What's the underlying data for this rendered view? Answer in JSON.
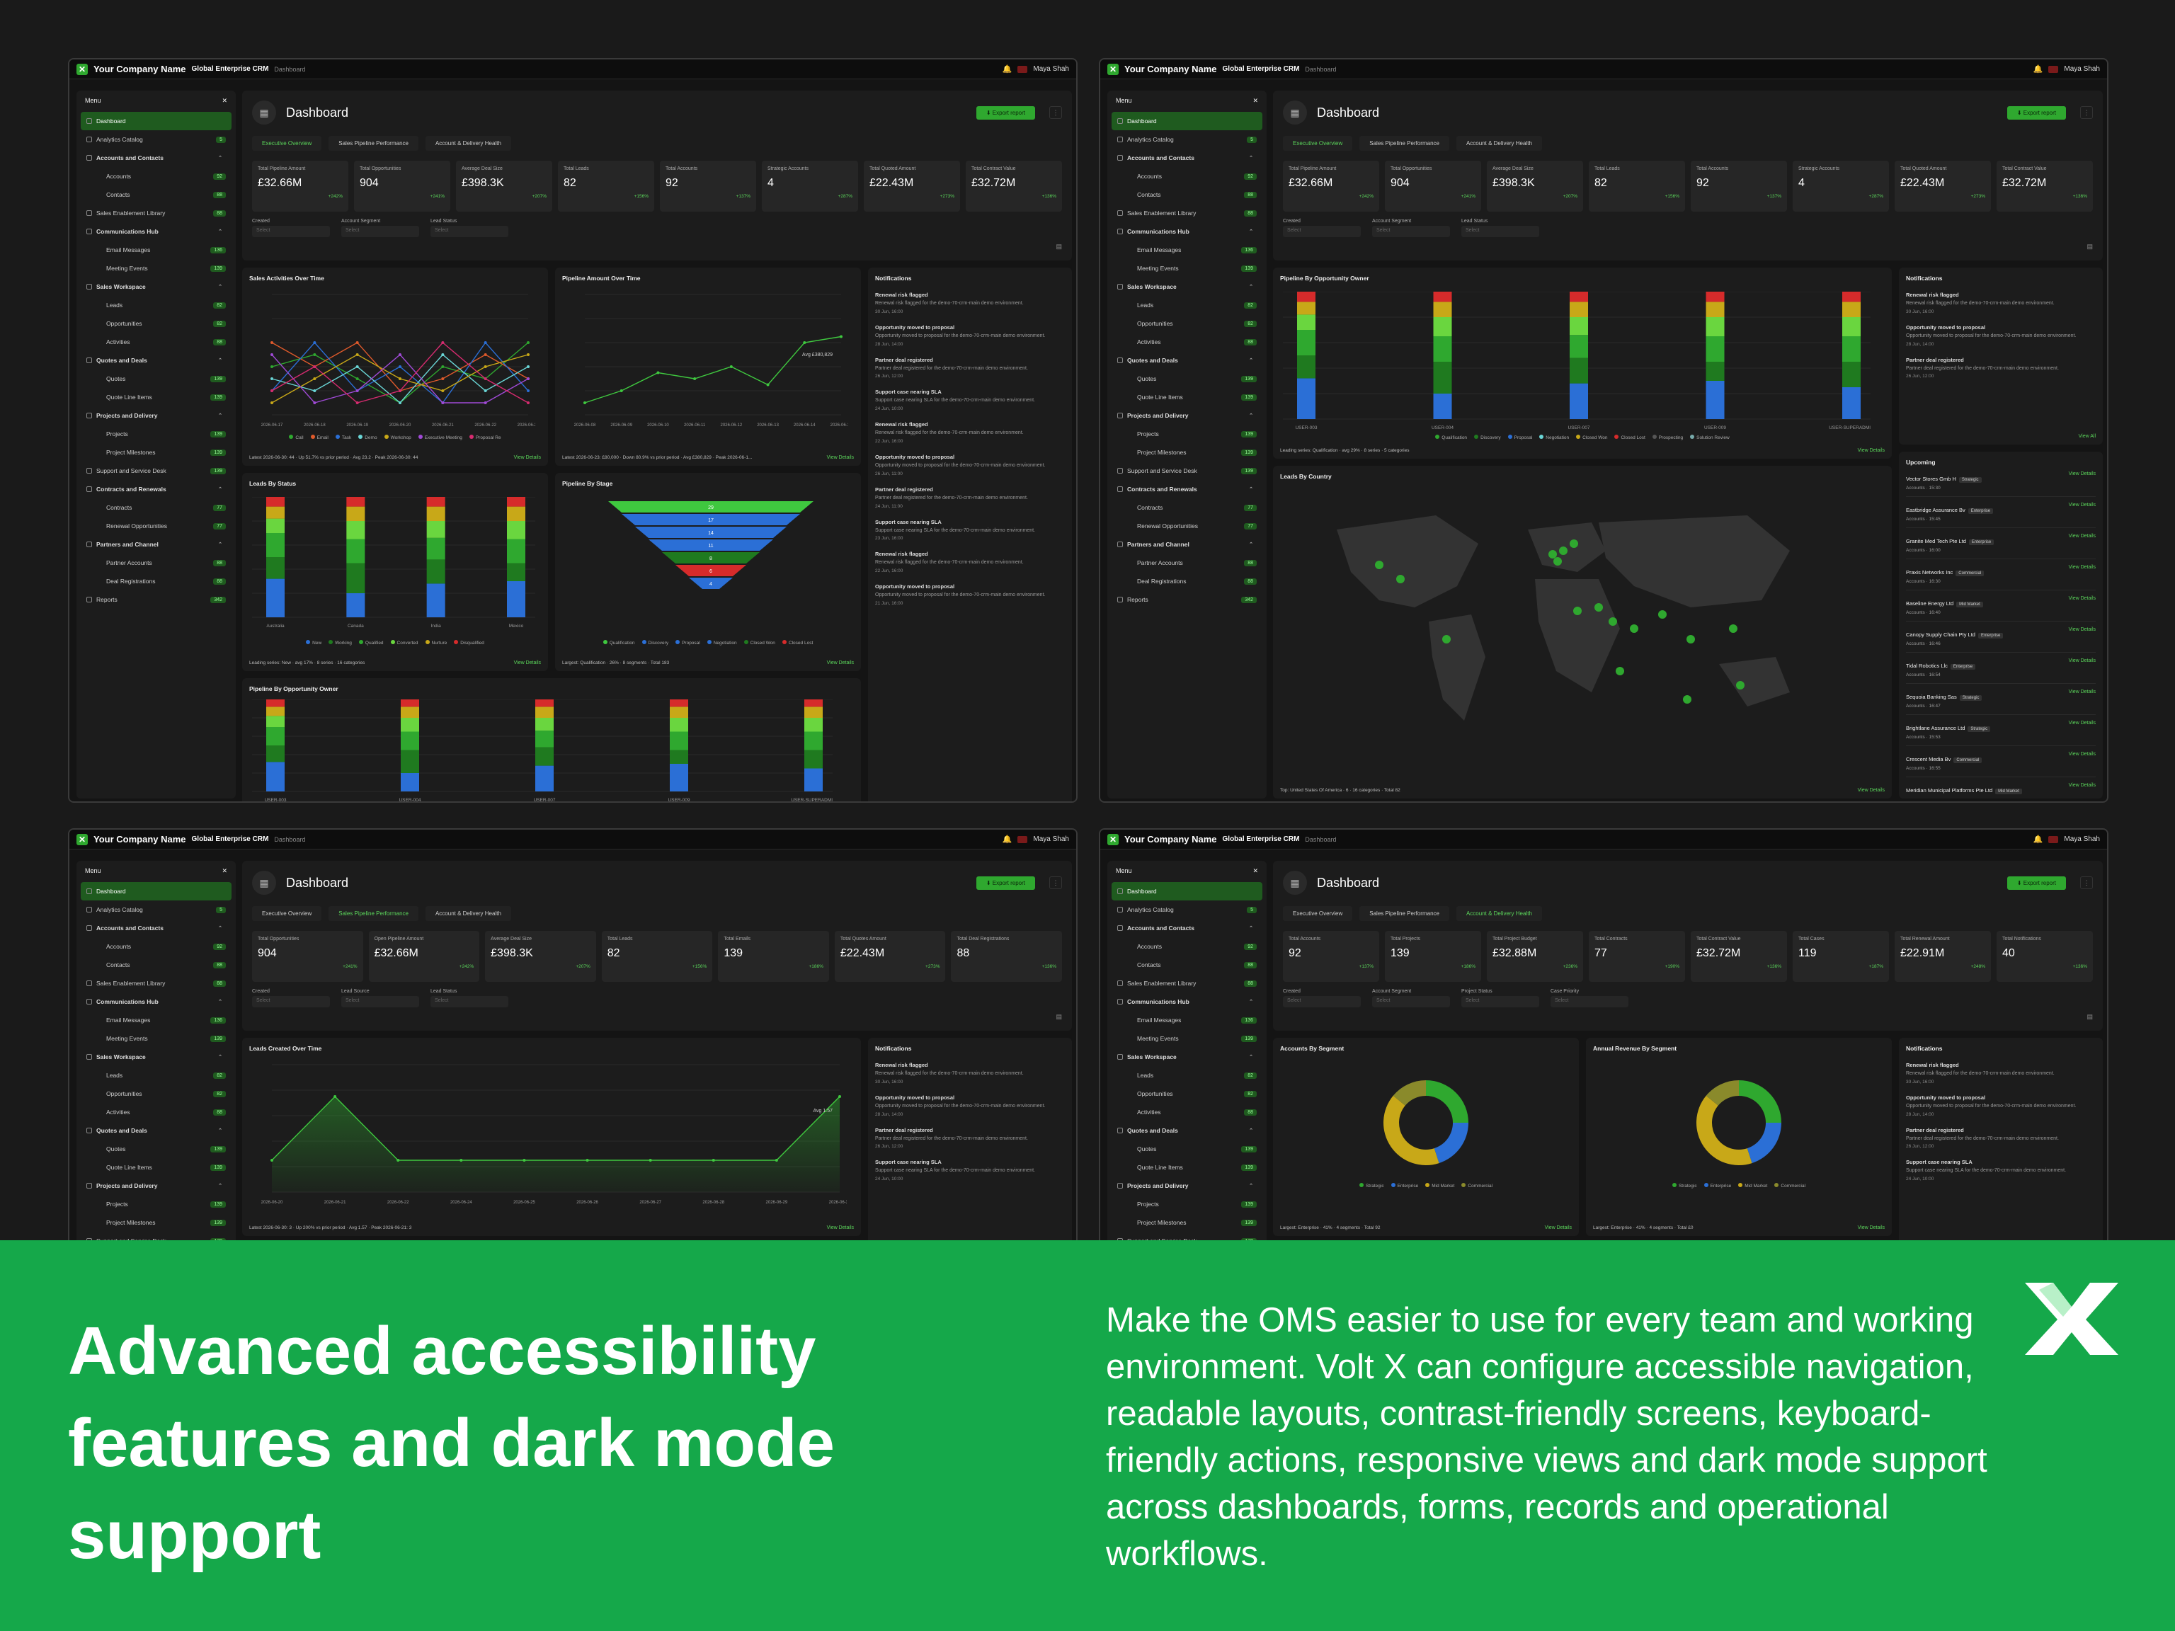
{
  "app": {
    "company": "Your Company Name",
    "crm": "Global Enterprise CRM",
    "crumb": "Dashboard",
    "user": "Maya Shah",
    "page_title": "Dashboard",
    "export_label": "Export report",
    "menu_label": "Menu"
  },
  "sidebar": {
    "items": [
      {
        "label": "Dashboard",
        "type": "active"
      },
      {
        "label": "Analytics Catalog",
        "type": "item",
        "badge": "5"
      },
      {
        "label": "Accounts and Contacts",
        "type": "sec"
      },
      {
        "label": "Accounts",
        "type": "sub",
        "badge": "92"
      },
      {
        "label": "Contacts",
        "type": "sub",
        "badge": "88"
      },
      {
        "label": "Sales Enablement Library",
        "type": "item",
        "badge": "88"
      },
      {
        "label": "Communications Hub",
        "type": "sec"
      },
      {
        "label": "Email Messages",
        "type": "sub",
        "badge": "136"
      },
      {
        "label": "Meeting Events",
        "type": "sub",
        "badge": "139"
      },
      {
        "label": "Sales Workspace",
        "type": "sec"
      },
      {
        "label": "Leads",
        "type": "sub",
        "badge": "82"
      },
      {
        "label": "Opportunities",
        "type": "sub",
        "badge": "82"
      },
      {
        "label": "Activities",
        "type": "sub",
        "badge": "88"
      },
      {
        "label": "Quotes and Deals",
        "type": "sec"
      },
      {
        "label": "Quotes",
        "type": "sub",
        "badge": "139"
      },
      {
        "label": "Quote Line Items",
        "type": "sub",
        "badge": "139"
      },
      {
        "label": "Projects and Delivery",
        "type": "sec"
      },
      {
        "label": "Projects",
        "type": "sub",
        "badge": "139"
      },
      {
        "label": "Project Milestones",
        "type": "sub",
        "badge": "139"
      },
      {
        "label": "Support and Service Desk",
        "type": "item",
        "badge": "139"
      },
      {
        "label": "Contracts and Renewals",
        "type": "sec"
      },
      {
        "label": "Contracts",
        "type": "sub",
        "badge": "77"
      },
      {
        "label": "Renewal Opportunities",
        "type": "sub",
        "badge": "77"
      },
      {
        "label": "Partners and Channel",
        "type": "sec"
      },
      {
        "label": "Partner Accounts",
        "type": "sub",
        "badge": "88"
      },
      {
        "label": "Deal Registrations",
        "type": "sub",
        "badge": "88"
      },
      {
        "label": "Reports",
        "type": "item",
        "badge": "342"
      }
    ]
  },
  "tabs": [
    "Executive Overview",
    "Sales Pipeline Performance",
    "Account & Delivery Health"
  ],
  "screens": {
    "s1": {
      "active_tab": 0,
      "kpis": [
        {
          "label": "Total Pipeline Amount",
          "value": "£32.66M",
          "delta": "+242%"
        },
        {
          "label": "Total Opportunities",
          "value": "904",
          "delta": "+241%"
        },
        {
          "label": "Average Deal Size",
          "value": "£398.3K",
          "delta": "+207%"
        },
        {
          "label": "Total Leads",
          "value": "82",
          "delta": "+156%"
        },
        {
          "label": "Total Accounts",
          "value": "92",
          "delta": "+137%"
        },
        {
          "label": "Strategic Accounts",
          "value": "4",
          "delta": "+287%"
        },
        {
          "label": "Total Quoted Amount",
          "value": "£22.43M",
          "delta": "+273%"
        },
        {
          "label": "Total Contract Value",
          "value": "£32.72M",
          "delta": "+136%"
        }
      ],
      "filters": [
        "Created",
        "Account Segment",
        "Lead Status"
      ],
      "filter_placeholder": "Select"
    },
    "s2": {
      "active_tab": 0,
      "kpis": [
        {
          "label": "Total Pipeline Amount",
          "value": "£32.66M",
          "delta": "+242%"
        },
        {
          "label": "Total Opportunities",
          "value": "904",
          "delta": "+241%"
        },
        {
          "label": "Average Deal Size",
          "value": "£398.3K",
          "delta": "+207%"
        },
        {
          "label": "Total Leads",
          "value": "82",
          "delta": "+156%"
        },
        {
          "label": "Total Accounts",
          "value": "92",
          "delta": "+137%"
        },
        {
          "label": "Strategic Accounts",
          "value": "4",
          "delta": "+287%"
        },
        {
          "label": "Total Quoted Amount",
          "value": "£22.43M",
          "delta": "+273%"
        },
        {
          "label": "Total Contract Value",
          "value": "£32.72M",
          "delta": "+136%"
        }
      ],
      "filters": [
        "Created",
        "Account Segment",
        "Lead Status"
      ],
      "filter_placeholder": "Select"
    },
    "s3": {
      "active_tab": 1,
      "kpis": [
        {
          "label": "Total Opportunities",
          "value": "904",
          "delta": "+241%"
        },
        {
          "label": "Open Pipeline Amount",
          "value": "£32.66M",
          "delta": "+242%"
        },
        {
          "label": "Average Deal Size",
          "value": "£398.3K",
          "delta": "+207%"
        },
        {
          "label": "Total Leads",
          "value": "82",
          "delta": "+156%"
        },
        {
          "label": "Total Emails",
          "value": "139",
          "delta": "+186%"
        },
        {
          "label": "Total Quotes Amount",
          "value": "£22.43M",
          "delta": "+273%"
        },
        {
          "label": "Total Deal Registrations",
          "value": "88",
          "delta": "+136%"
        }
      ],
      "filters": [
        "Created",
        "Lead Source",
        "Lead Status"
      ],
      "filter_placeholder": "Select"
    },
    "s4": {
      "active_tab": 2,
      "kpis": [
        {
          "label": "Total Accounts",
          "value": "92",
          "delta": "+137%"
        },
        {
          "label": "Total Projects",
          "value": "139",
          "delta": "+186%"
        },
        {
          "label": "Total Project Budget",
          "value": "£32.88M",
          "delta": "+236%"
        },
        {
          "label": "Total Contracts",
          "value": "77",
          "delta": "+190%"
        },
        {
          "label": "Total Contract Value",
          "value": "£32.72M",
          "delta": "+136%"
        },
        {
          "label": "Total Cases",
          "value": "119",
          "delta": "+187%"
        },
        {
          "label": "Total Renewal Amount",
          "value": "£22.91M",
          "delta": "+248%"
        },
        {
          "label": "Total Notifications",
          "value": "40",
          "delta": "+136%"
        }
      ],
      "filters": [
        "Created",
        "Account Segment",
        "Project Status",
        "Case Priority"
      ],
      "filter_placeholder": "Select"
    }
  },
  "panels": {
    "sales_activities": {
      "title": "Sales Activities Over Time",
      "foot": "Latest 2026-06-30: 44 · Up 51.7% vs prior period · Avg 23.2 · Peak 2026-06-30: 44",
      "link": "View Details",
      "legend": [
        "Call",
        "Email",
        "Task",
        "Demo",
        "Workshop",
        "Executive Meeting",
        "Proposal Re"
      ]
    },
    "pipeline_amount": {
      "title": "Pipeline Amount Over Time",
      "foot": "Latest 2026-06-23: £80,000 · Down 80.9% vs prior period · Avg £380,829 · Peak 2026-06-1...",
      "link": "View Details",
      "avg_label": "Avg £380,829"
    },
    "leads_status": {
      "title": "Leads By Status",
      "foot": "Leading series: New · avg 17% · 8 series · 16 categories",
      "link": "View Details",
      "categories": [
        "Australia",
        "Canada",
        "India",
        "Mexico"
      ],
      "legend": [
        "New",
        "Working",
        "Qualified",
        "Converted",
        "Nurture",
        "Disqualified"
      ]
    },
    "pipeline_stage": {
      "title": "Pipeline By Stage",
      "foot": "Largest: Qualification · 26% · 8 segments · Total 183",
      "link": "View Details",
      "legend": [
        "Qualification",
        "Discovery",
        "Proposal",
        "Negotiation",
        "Closed Won",
        "Closed Lost"
      ],
      "values": [
        "29",
        "17",
        "14",
        "11",
        "8",
        "6",
        "4"
      ]
    },
    "pipeline_owner": {
      "title": "Pipeline By Opportunity Owner",
      "foot": "Leading series: Qualification · avg 29% · 8 series · 5 categories",
      "link": "View Details",
      "categories": [
        "USER-003",
        "USER-004",
        "USER-007",
        "USER-009",
        "USER-SUPERADMIN"
      ],
      "legend": [
        "Qualification",
        "Discovery",
        "Proposal",
        "Negotiation",
        "Closed Won",
        "Closed Lost",
        "Prospecting",
        "Solution Review"
      ]
    },
    "leads_country": {
      "title": "Leads By Country",
      "foot": "Top: United States Of America · 6 · 16 categories · Total 82",
      "link": "View Details"
    },
    "notifications": {
      "title": "Notifications",
      "items": [
        {
          "t": "Renewal risk flagged",
          "d": "Renewal risk flagged for the demo-70-crm-main demo environment.",
          "m": "30 Jun, 16:00"
        },
        {
          "t": "Opportunity moved to proposal",
          "d": "Opportunity moved to proposal for the demo-70-crm-main demo environment.",
          "m": "28 Jun, 14:00"
        },
        {
          "t": "Partner deal registered",
          "d": "Partner deal registered for the demo-70-crm-main demo environment.",
          "m": "26 Jun, 12:00"
        },
        {
          "t": "Support case nearing SLA",
          "d": "Support case nearing SLA for the demo-70-crm-main demo environment.",
          "m": "24 Jun, 10:00"
        },
        {
          "t": "Renewal risk flagged",
          "d": "Renewal risk flagged for the demo-70-crm-main demo environment.",
          "m": "22 Jun, 16:00"
        },
        {
          "t": "Opportunity moved to proposal",
          "d": "Opportunity moved to proposal for the demo-70-crm-main demo environment.",
          "m": "26 Jun, 11:00"
        },
        {
          "t": "Partner deal registered",
          "d": "Partner deal registered for the demo-70-crm-main demo environment.",
          "m": "24 Jun, 11:00"
        },
        {
          "t": "Support case nearing SLA",
          "d": "Support case nearing SLA for the demo-70-crm-main demo environment.",
          "m": "23 Jun, 16:00"
        },
        {
          "t": "Renewal risk flagged",
          "d": "Renewal risk flagged for the demo-70-crm-main demo environment.",
          "m": "22 Jun, 16:00"
        },
        {
          "t": "Opportunity moved to proposal",
          "d": "Opportunity moved to proposal for the demo-70-crm-main demo environment.",
          "m": "21 Jun, 16:00"
        }
      ],
      "view_all": "View All"
    },
    "upcoming": {
      "title": "Upcoming",
      "items": [
        {
          "n": "Vector Stores Gmb H",
          "tag": "Strategic",
          "s": "Accounts · 15:30"
        },
        {
          "n": "Eastbridge Assurance Bv",
          "tag": "Enterprise",
          "s": "Accounts · 15:45"
        },
        {
          "n": "Granite Med Tech Pte Ltd",
          "tag": "Enterprise",
          "s": "Accounts · 16:00"
        },
        {
          "n": "Praxis Networks Inc",
          "tag": "Commercial",
          "s": "Accounts · 16:30"
        },
        {
          "n": "Baseline Energy Ltd",
          "tag": "Mid Market",
          "s": "Accounts · 16:40"
        },
        {
          "n": "Canopy Supply Chain Pty Ltd",
          "tag": "Enterprise",
          "s": "Accounts · 16:46"
        },
        {
          "n": "Tidal Robotics Llc",
          "tag": "Enterprise",
          "s": "Accounts · 16:54"
        },
        {
          "n": "Sequoia Banking Sas",
          "tag": "Strategic",
          "s": "Accounts · 16:47"
        },
        {
          "n": "Brightlane Assurance Ltd",
          "tag": "Strategic",
          "s": "Accounts · 15:53"
        },
        {
          "n": "Crescent Media Bv",
          "tag": "Commercial",
          "s": "Accounts · 16:55"
        },
        {
          "n": "Meridian Municipal Platforms Pte Ltd",
          "tag": "Mid Market",
          "s": ""
        }
      ],
      "link": "View Details"
    },
    "leads_created": {
      "title": "Leads Created Over Time",
      "foot": "Latest 2026-06-30: 3 · Up 200% vs prior period · Avg 1.57 · Peak 2026-06-21: 3",
      "link": "View Details",
      "avg_label": "Avg 1.57"
    },
    "accounts_segment": {
      "title": "Accounts By Segment",
      "foot": "Largest: Enterprise · 41% · 4 segments · Total 92",
      "link": "View Details",
      "legend": [
        "Strategic",
        "Enterprise",
        "Mid Market",
        "Commercial"
      ],
      "labels": [
        "00%",
        "00%",
        "00%",
        "41%"
      ]
    },
    "revenue_segment": {
      "title": "Annual Revenue By Segment",
      "foot": "Largest: Enterprise · 41% · 4 segments · Total £0",
      "link": "View Details",
      "legend": [
        "Strategic",
        "Enterprise",
        "Mid Market",
        "Commercial"
      ],
      "labels": [
        "00%",
        "00%",
        "00%",
        "41%"
      ]
    }
  },
  "banner": {
    "headline": "Advanced accessibility features and dark mode support",
    "body": "Make the OMS easier to use for every team and working environment. Volt X can configure accessible navigation, readable layouts, contrast-friendly screens, keyboard-friendly actions, responsive views and dark mode support across dashboards, forms, records and operational workflows."
  },
  "colors": {
    "accent": "#2fa82f",
    "banner": "#15a84a",
    "bg": "#1a1a1a",
    "panel": "#1c1c1c"
  },
  "icons": [
    "dashboard-icon",
    "bell-icon",
    "download-icon",
    "menu-icon",
    "calendar-icon",
    "volt-x-logo"
  ],
  "chart_data": [
    {
      "type": "line",
      "title": "Sales Activities Over Time",
      "x": [
        "2026-06-17",
        "2026-06-18",
        "2026-06-19",
        "2026-06-20",
        "2026-06-21",
        "2026-06-22",
        "2026-06-23"
      ],
      "ylim": [
        0,
        10
      ],
      "series": [
        {
          "name": "Call",
          "values": [
            4,
            5,
            3,
            1,
            4,
            3,
            6
          ]
        },
        {
          "name": "Email",
          "values": [
            6,
            4,
            6,
            2,
            3,
            5,
            3
          ]
        },
        {
          "name": "Task",
          "values": [
            2,
            6,
            2,
            4,
            1,
            6,
            2
          ]
        },
        {
          "name": "Demo",
          "values": [
            3,
            2,
            4,
            1,
            5,
            2,
            4
          ]
        },
        {
          "name": "Workshop",
          "values": [
            1,
            3,
            5,
            3,
            2,
            4,
            5
          ]
        },
        {
          "name": "Executive Meeting",
          "values": [
            5,
            1,
            2,
            5,
            1,
            1,
            3
          ]
        },
        {
          "name": "Proposal Re",
          "values": [
            2,
            4,
            1,
            2,
            6,
            3,
            1
          ]
        }
      ]
    },
    {
      "type": "line",
      "title": "Pipeline Amount Over Time",
      "x": [
        "2026-06-08",
        "2026-06-09",
        "2026-06-10",
        "2026-06-11",
        "2026-06-12",
        "2026-06-13",
        "2026-06-14",
        "2026-06-15"
      ],
      "ylim": [
        0,
        2000000
      ],
      "series": [
        {
          "name": "Pipeline Amount",
          "values": [
            200000,
            400000,
            700000,
            600000,
            800000,
            500000,
            1200000,
            1300000
          ]
        }
      ]
    },
    {
      "type": "line",
      "title": "Leads Created Over Time",
      "x": [
        "2026-06-20",
        "2026-06-21",
        "2026-06-22",
        "2026-06-24",
        "2026-06-25",
        "2026-06-26",
        "2026-06-27",
        "2026-06-28",
        "2026-06-29",
        "2026-06-30"
      ],
      "ylim": [
        0,
        4
      ],
      "series": [
        {
          "name": "Leads",
          "values": [
            1,
            3,
            1,
            1,
            1,
            1,
            1,
            1,
            1,
            3
          ]
        }
      ]
    }
  ]
}
